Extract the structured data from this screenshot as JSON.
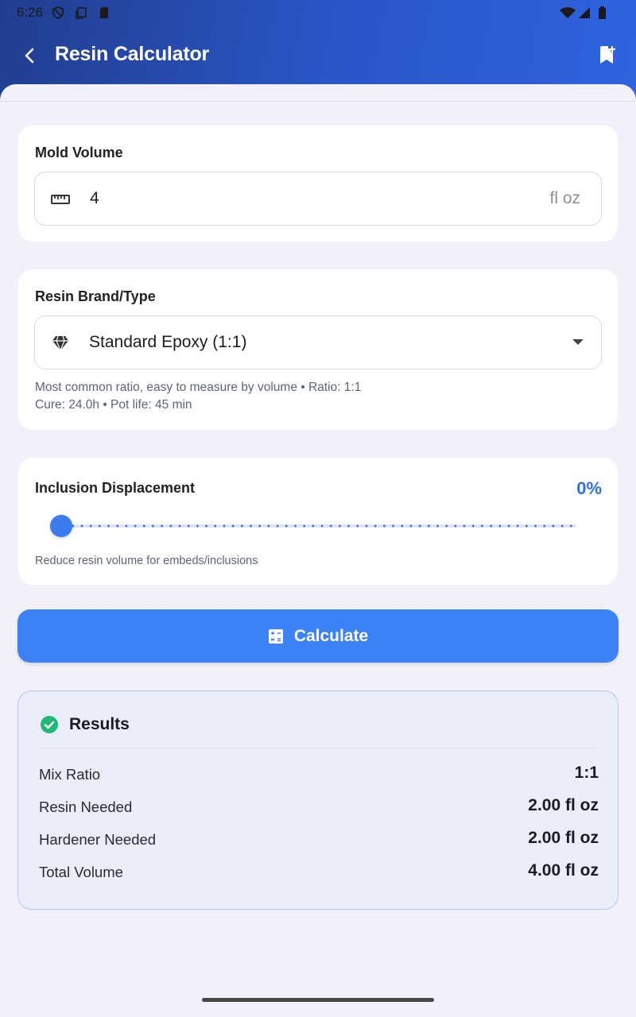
{
  "status_bar": {
    "time": "6:26"
  },
  "app_bar": {
    "title": "Resin Calculator"
  },
  "mold_volume": {
    "label": "Mold Volume",
    "value": "4",
    "unit": "fl oz"
  },
  "resin_type": {
    "label": "Resin Brand/Type",
    "selected": "Standard Epoxy (1:1)",
    "description_line1": "Most common ratio, easy to measure by volume • Ratio: 1:1",
    "description_line2": "Cure: 24.0h • Pot life: 45 min"
  },
  "inclusion": {
    "label": "Inclusion Displacement",
    "percent_display": "0%",
    "slider_value": 0,
    "helper": "Reduce resin volume for embeds/inclusions"
  },
  "calculate_button": {
    "label": "Calculate"
  },
  "results": {
    "title": "Results",
    "rows": [
      {
        "label": "Mix Ratio",
        "value": "1:1"
      },
      {
        "label": "Resin Needed",
        "value": "2.00 fl oz"
      },
      {
        "label": "Hardener Needed",
        "value": "2.00 fl oz"
      },
      {
        "label": "Total Volume",
        "value": "4.00 fl oz"
      }
    ]
  },
  "colors": {
    "primary": "#3b82f6",
    "header_start": "#213e8f",
    "header_end": "#2f63e0",
    "success": "#1fb879",
    "accent_text": "#2f6fe4"
  }
}
